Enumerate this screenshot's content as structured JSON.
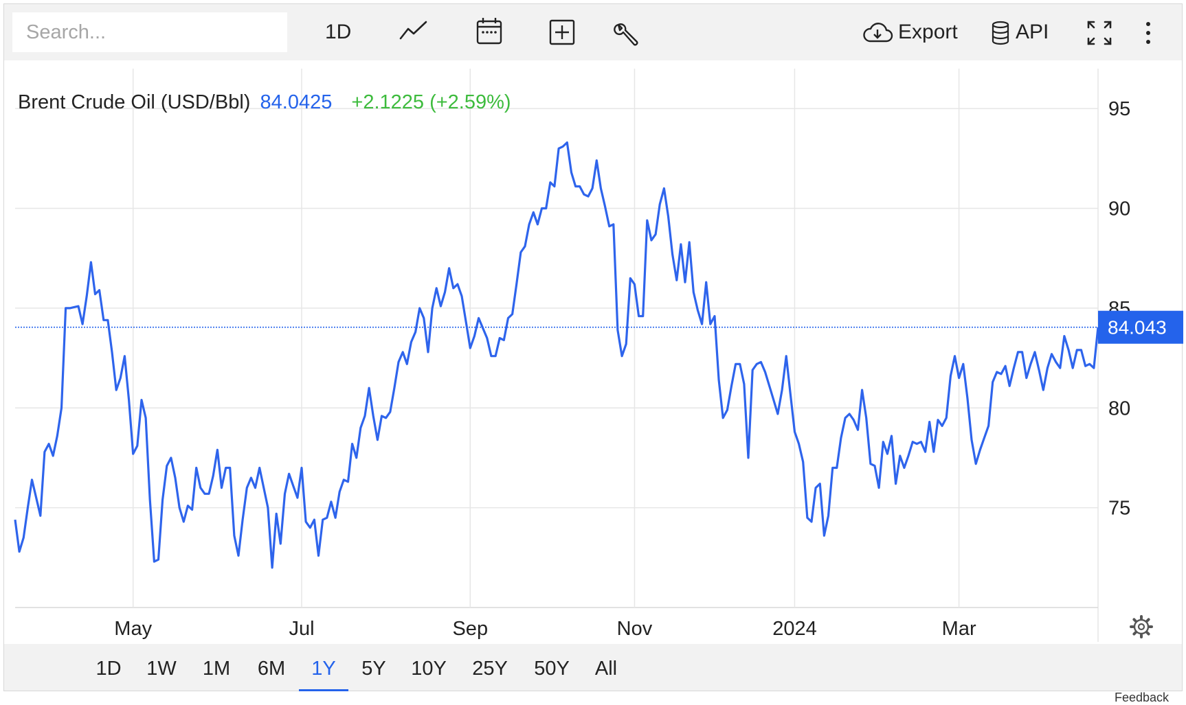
{
  "toolbar": {
    "search_placeholder": "Search...",
    "interval_label": "1D",
    "export_label": "Export",
    "api_label": "API",
    "icons": [
      "line-chart-icon",
      "calendar-icon",
      "add-box-icon",
      "wrench-icon",
      "cloud-download-icon",
      "database-icon",
      "fullscreen-icon",
      "more-vertical-icon"
    ]
  },
  "legend": {
    "name": "Brent Crude Oil (USD/Bbl)",
    "price": "84.0425",
    "change": "+2.1225 (+2.59%)"
  },
  "last_value_label": "84.043",
  "range_buttons": [
    "1D",
    "1W",
    "1M",
    "6M",
    "1Y",
    "5Y",
    "10Y",
    "25Y",
    "50Y",
    "All"
  ],
  "active_range": "1Y",
  "footer_text": "Feedback",
  "colors": {
    "line": "#2e64ec",
    "accent": "#2463eb",
    "positive": "#3dbb3d",
    "grid": "#e6e6e6",
    "toolbar_bg": "#f2f2f2"
  },
  "chart_data": {
    "type": "line",
    "title": "Brent Crude Oil (USD/Bbl)",
    "xlabel": "",
    "ylabel": "",
    "ylim": [
      70,
      97
    ],
    "y_ticks": [
      75,
      80,
      85,
      90,
      95
    ],
    "x_ticks": [
      "May",
      "Jul",
      "Sep",
      "Nov",
      "2024",
      "Mar"
    ],
    "x_tick_index": [
      28,
      68,
      108,
      147,
      185,
      224
    ],
    "grid": true,
    "last_value": 84.043,
    "series": [
      {
        "name": "Brent Crude Oil",
        "values": [
          74.4,
          72.8,
          73.5,
          75.0,
          76.4,
          75.5,
          74.6,
          77.8,
          78.2,
          77.6,
          78.6,
          80.0,
          85.0,
          85.0,
          85.05,
          85.1,
          84.2,
          85.6,
          87.3,
          85.7,
          85.9,
          84.4,
          84.4,
          82.8,
          80.9,
          81.5,
          82.6,
          80.4,
          77.7,
          78.1,
          80.4,
          79.5,
          75.4,
          72.3,
          72.4,
          75.4,
          77.1,
          77.5,
          76.5,
          75.0,
          74.3,
          75.1,
          74.9,
          77.0,
          76.0,
          75.7,
          75.7,
          76.6,
          77.9,
          76.0,
          77.0,
          77.0,
          73.6,
          72.6,
          74.4,
          76.0,
          76.5,
          76.0,
          77.0,
          76.0,
          75.0,
          72.0,
          74.7,
          73.2,
          75.7,
          76.7,
          76.1,
          75.5,
          77.0,
          74.3,
          74.0,
          74.4,
          72.6,
          74.4,
          74.5,
          75.3,
          74.5,
          75.8,
          76.4,
          76.3,
          78.2,
          77.5,
          79.0,
          79.6,
          81.0,
          79.6,
          78.4,
          79.6,
          79.5,
          79.8,
          81.0,
          82.3,
          82.8,
          82.2,
          83.3,
          83.8,
          85.0,
          84.5,
          82.8,
          85.0,
          86.0,
          85.1,
          85.8,
          87.0,
          86.0,
          86.2,
          85.6,
          84.3,
          83.0,
          83.6,
          84.5,
          84.0,
          83.5,
          82.6,
          82.6,
          83.5,
          83.4,
          84.5,
          84.7,
          86.2,
          87.8,
          88.1,
          89.2,
          89.8,
          89.2,
          90.0,
          90.0,
          91.3,
          91.1,
          93.0,
          93.1,
          93.3,
          91.8,
          91.1,
          91.1,
          90.7,
          90.6,
          91.0,
          92.4,
          91.0,
          90.1,
          89.1,
          89.2,
          83.9,
          82.6,
          83.2,
          86.5,
          86.2,
          84.6,
          84.6,
          89.4,
          88.4,
          88.7,
          90.2,
          91.0,
          89.6,
          87.7,
          86.4,
          88.2,
          86.3,
          88.3,
          85.8,
          84.9,
          84.2,
          86.3,
          84.2,
          84.6,
          81.4,
          79.5,
          79.9,
          81.1,
          82.2,
          82.2,
          81.2,
          77.5,
          81.9,
          82.2,
          82.3,
          81.8,
          81.1,
          80.4,
          79.7,
          80.9,
          82.6,
          80.7,
          78.8,
          78.2,
          77.3,
          74.5,
          74.3,
          76.0,
          76.2,
          73.6,
          74.6,
          77.0,
          77.0,
          78.5,
          79.5,
          79.7,
          79.4,
          78.9,
          80.9,
          79.5,
          77.2,
          77.1,
          76.0,
          78.3,
          77.7,
          78.6,
          76.2,
          77.6,
          77.0,
          77.6,
          78.3,
          78.2,
          78.3,
          77.8,
          79.3,
          77.8,
          79.4,
          79.1,
          79.5,
          81.6,
          82.6,
          81.5,
          82.2,
          80.5,
          78.4,
          77.2,
          77.9,
          78.5,
          79.1,
          81.3,
          81.8,
          81.7,
          82.1,
          81.1,
          82.0,
          82.8,
          82.8,
          81.5,
          82.2,
          82.8,
          81.9,
          80.9,
          82.0,
          82.7,
          82.3,
          82.0,
          83.6,
          82.9,
          82.0,
          82.9,
          82.9,
          82.1,
          82.2,
          82.0,
          84.0425
        ]
      }
    ]
  }
}
